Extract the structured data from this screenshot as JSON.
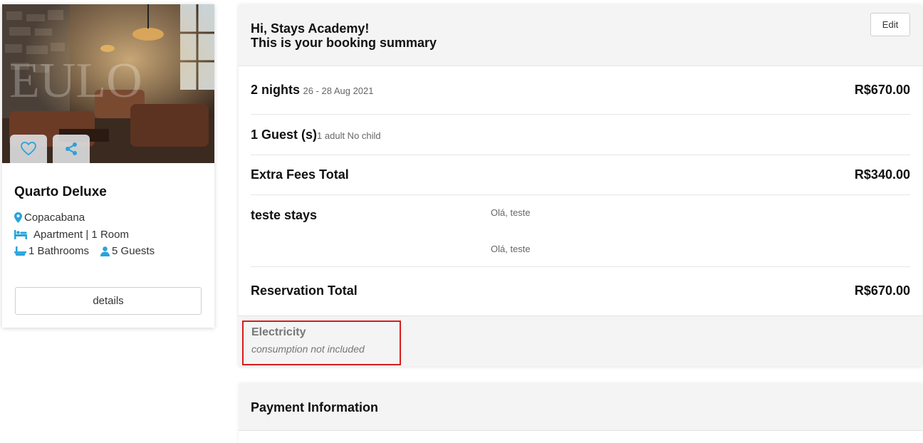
{
  "listing": {
    "title": "Quarto Deluxe",
    "location": "Copacabana",
    "type": "Apartment | 1 Room",
    "bathrooms": "1 Bathrooms",
    "guests": "5 Guests",
    "details_label": "details",
    "photo_icons": [
      "heart-icon",
      "share-icon"
    ]
  },
  "summary": {
    "greeting": "Hi, Stays Academy!",
    "subtitle": "This is your booking summary",
    "edit_label": "Edit",
    "nights": {
      "label": "2 nights",
      "dates": "26 - 28 Aug 2021",
      "amount": "R$670.00"
    },
    "guests": {
      "label": "1 Guest (s)",
      "detail": "1 adult No child"
    },
    "fees": {
      "label": "Extra Fees Total",
      "amount": "R$340.00"
    },
    "extra_item": {
      "label": "teste stays",
      "notes": [
        "Olá, teste",
        "Olá, teste"
      ]
    },
    "total": {
      "label": "Reservation Total",
      "amount": "R$670.00"
    },
    "electricity": {
      "title": "Electricity",
      "note": "consumption not included"
    }
  },
  "payment": {
    "title": "Payment Information"
  },
  "colors": {
    "accent": "#29a3d9",
    "highlight_border": "#d91c1c",
    "panel_bg": "#f4f4f4"
  }
}
